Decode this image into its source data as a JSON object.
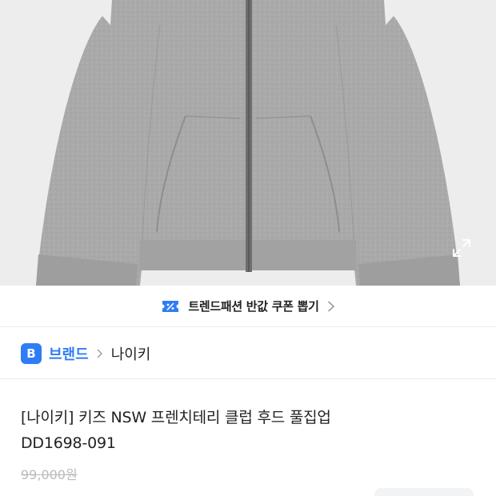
{
  "product_image": {
    "alt": "",
    "expand_icon": "expand-arrows-icon"
  },
  "coupon_banner": {
    "icon": "coupon-ticket-icon",
    "text": "트렌드패션 반값 쿠폰 뽑기",
    "chevron": "chevron-right-icon",
    "accent_color": "#2f7df6"
  },
  "brand_row": {
    "badge": "B",
    "brand_link": "브랜드",
    "separator_icon": "chevron-right-icon",
    "brand_name": "나이키",
    "accent_color": "#2f7df6"
  },
  "product": {
    "title_line1": "[나이키] 키즈 NSW 프렌치테리 클럽 후드 풀집업",
    "title_line2": "DD1698-091",
    "original_price": "99,000원"
  }
}
